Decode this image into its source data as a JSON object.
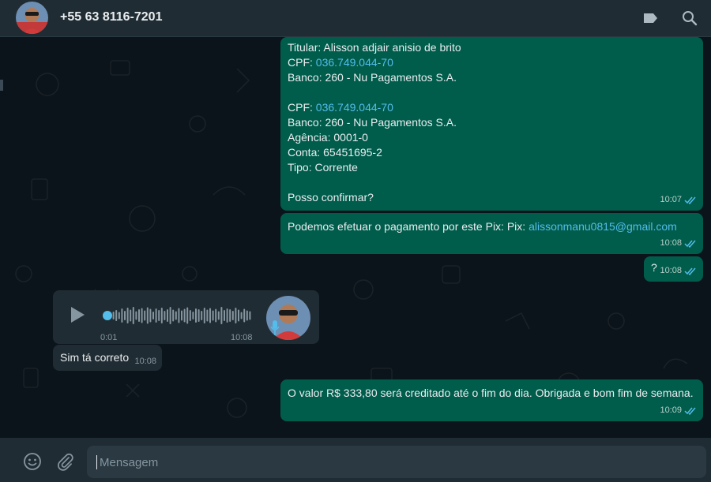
{
  "header": {
    "contact_name": "+55 63 8116-7201",
    "icons": [
      "avatar",
      "label-icon",
      "search-icon"
    ]
  },
  "messages": {
    "m1": {
      "line1_prefix": "Titular: ",
      "line1_value": "Alisson adjair anisio de brito",
      "cpf1_label": "CPF: ",
      "cpf1_value": "036.749.044-70",
      "banco1": "Banco: 260 - Nu Pagamentos S.A.",
      "cpf2_label": "CPF: ",
      "cpf2_value": "036.749.044-70",
      "banco2": "Banco: 260 - Nu Pagamentos S.A.",
      "agencia": "Agência: 0001-0",
      "conta": "Conta: 65451695-2",
      "tipo": "Tipo: Corrente",
      "pergunta": "Posso confirmar?",
      "time": "10:07"
    },
    "m2": {
      "text": "Podemos efetuar o pagamento por este Pix: Pix: ",
      "email": "alissonmanu0815@gmail.com",
      "time": "10:08"
    },
    "m3": {
      "text": "?",
      "time": "10:08"
    },
    "voice": {
      "elapsed": "0:01",
      "time": "10:08",
      "progress": 0.0
    },
    "m4": {
      "text": "Sim tá correto",
      "time": "10:08"
    },
    "m5": {
      "text": "O valor R$ 333,80 será creditado até o fim do dia. Obrigada e bom fim de semana.",
      "time": "10:09"
    }
  },
  "composer": {
    "placeholder": "Mensagem",
    "icons": [
      "emoji-icon",
      "attach-icon"
    ]
  },
  "colors": {
    "outgoing": "#005c4b",
    "incoming": "#202c33",
    "link": "#53bdeb",
    "read_ticks": "#53bdeb"
  }
}
